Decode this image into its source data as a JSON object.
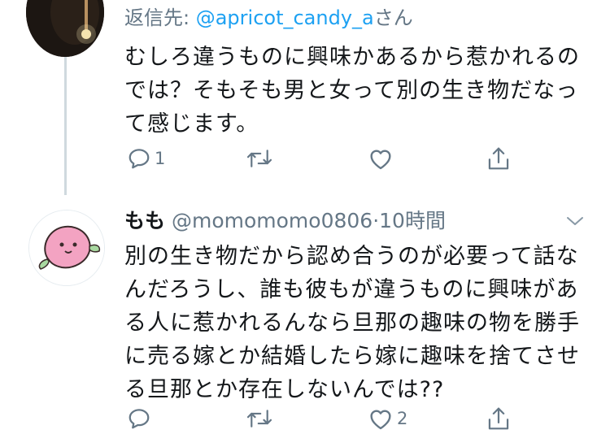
{
  "tweet_1": {
    "reply_prefix": "返信先: ",
    "reply_handle": "@apricot_candy_a",
    "reply_suffix": "さん",
    "text": "むしろ違うものに興味かあるから惹かれるの\nでは？そもそも男と女って別の生き物だなっ\nて感じます。",
    "reply_count": "1",
    "like_count": ""
  },
  "tweet_2": {
    "name": "もも",
    "handle": "@momomomo0806",
    "separator": "·",
    "time": "10時間",
    "text": "別の生き物だから認め合うのが必要って話な\nんだろうし、誰も彼もが違うものに興味があ\nる人に惹かれるんなら旦那の趣味の物を勝手\nに売る嫁とか結婚したら嫁に趣味を捨てさせ\nる旦那とか存在しないんでは??",
    "reply_count": "",
    "like_count": "2"
  },
  "colors": {
    "text": "#14171a",
    "muted": "#657786",
    "link": "#1da1f2",
    "thread_line": "#cfd9de"
  },
  "icons": [
    "reply-icon",
    "retweet-icon",
    "like-icon",
    "share-icon",
    "chevron-down-icon"
  ]
}
